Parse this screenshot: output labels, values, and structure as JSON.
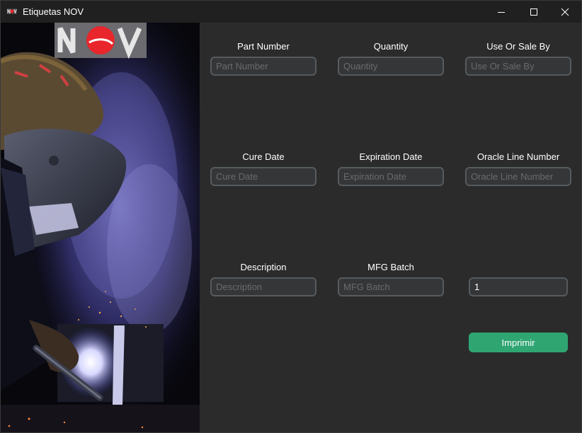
{
  "window": {
    "title": "Etiquetas NOV",
    "icon": "nov-logo-icon",
    "controls": [
      "minimize-icon",
      "maximize-icon",
      "close-icon"
    ]
  },
  "side_image": {
    "description_icon": "welder-photo",
    "logo_text": "NOV"
  },
  "form": {
    "part_number": {
      "label": "Part Number",
      "placeholder": "Part Number",
      "value": ""
    },
    "quantity": {
      "label": "Quantity",
      "placeholder": "Quantity",
      "value": ""
    },
    "use_or_sale_by": {
      "label": "Use Or Sale By",
      "placeholder": "Use Or Sale By",
      "value": ""
    },
    "cure_date": {
      "label": "Cure Date",
      "placeholder": "Cure Date",
      "value": ""
    },
    "expiration_date": {
      "label": "Expiration Date",
      "placeholder": "Expiration Date",
      "value": ""
    },
    "oracle_line_number": {
      "label": "Oracle Line Number",
      "placeholder": "Oracle Line Number",
      "value": ""
    },
    "description": {
      "label": "Description",
      "placeholder": "Description",
      "value": ""
    },
    "mfg_batch": {
      "label": "MFG Batch",
      "placeholder": "MFG Batch",
      "value": ""
    },
    "copies": {
      "value": "1"
    },
    "print_button": "Imprimir"
  },
  "colors": {
    "background": "#2b2b2b",
    "titlebar": "#202020",
    "field_bg": "#343638",
    "field_border": "#565b5e",
    "accent": "#2fa572",
    "logo_red": "#e8262b"
  }
}
